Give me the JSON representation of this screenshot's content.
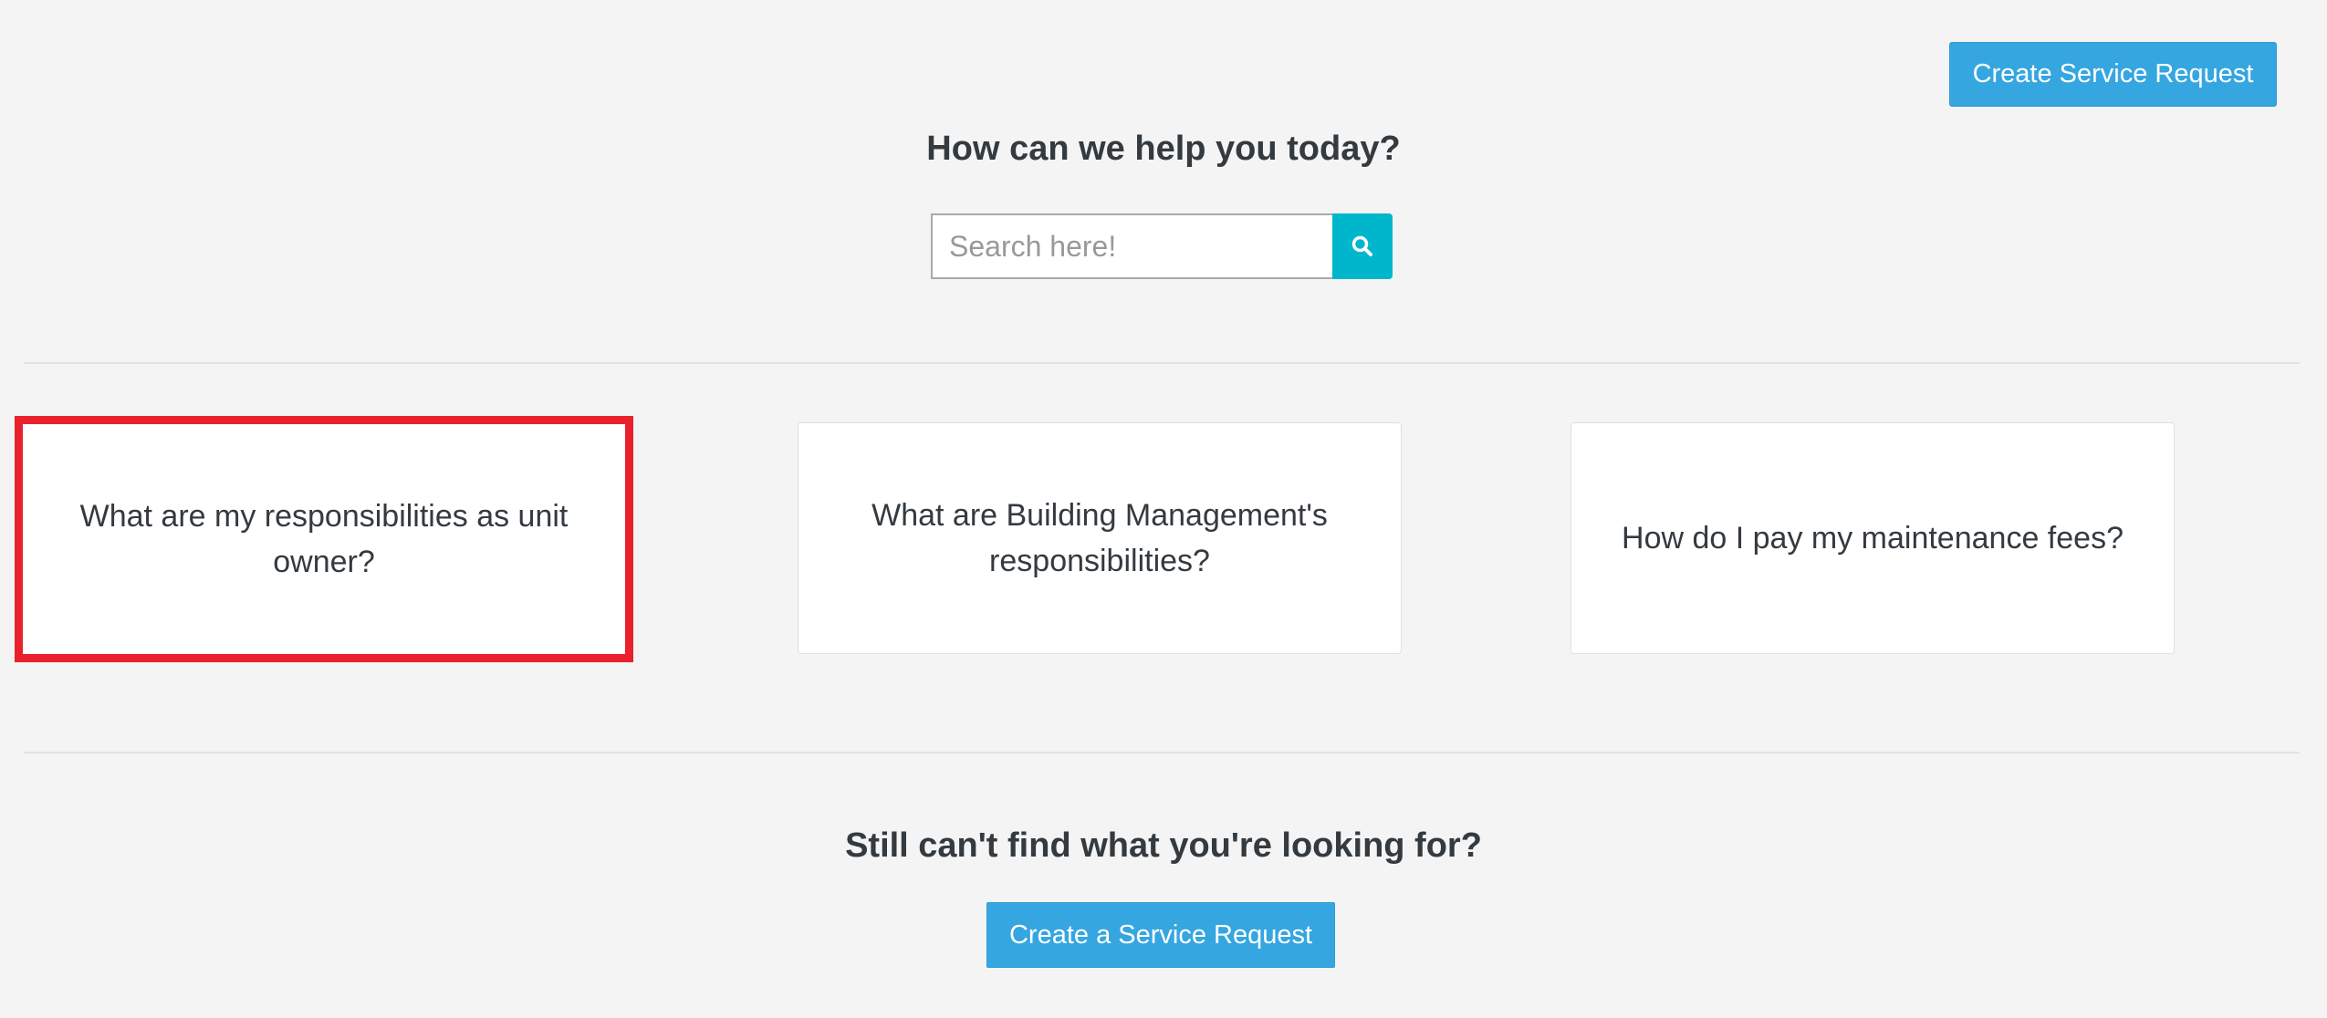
{
  "header": {
    "create_request_label": "Create Service Request"
  },
  "help": {
    "title": "How can we help you today?"
  },
  "search": {
    "placeholder": "Search here!",
    "value": "",
    "button_icon": "search-icon",
    "button_color": "#00b6cc"
  },
  "faq": {
    "cards": [
      {
        "label": "What are my responsibilities as unit owner?",
        "highlighted": true
      },
      {
        "label": "What are Building Management's responsibilities?"
      },
      {
        "label": "How do I pay my maintenance fees?"
      }
    ],
    "highlight_color": "#e8212c"
  },
  "footer": {
    "title": "Still can't find what you're looking for?",
    "create_request_label": "Create a Service Request"
  },
  "colors": {
    "accent": "#35a6e0",
    "background": "#f4f4f4"
  }
}
